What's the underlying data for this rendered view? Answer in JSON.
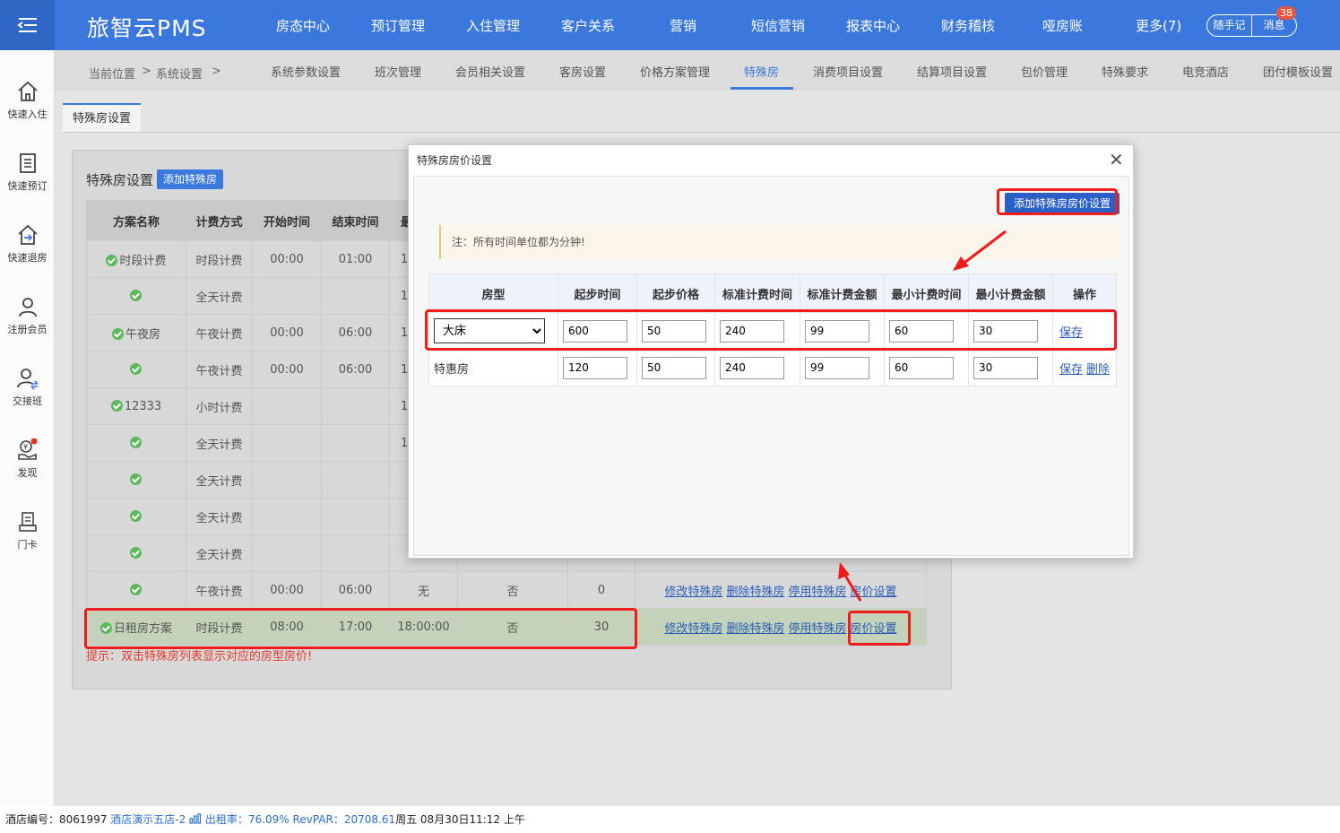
{
  "topbar": {
    "logo": "旅智云PMS",
    "nav": [
      "房态中心",
      "预订管理",
      "入住管理",
      "客户关系",
      "营销",
      "短信营销",
      "报表中心",
      "财务稽核",
      "哑房账",
      "更多(7)"
    ],
    "notes_label": "随手记",
    "messages_label": "消息",
    "messages_count": "38"
  },
  "sidebar": [
    {
      "label": "快速入住",
      "icon": "home-icon"
    },
    {
      "label": "快速预订",
      "icon": "booking-list-icon"
    },
    {
      "label": "快速退房",
      "icon": "checkout-icon"
    },
    {
      "label": "注册会员",
      "icon": "member-icon"
    },
    {
      "label": "交接班",
      "icon": "shift-swap-icon"
    },
    {
      "label": "发现",
      "icon": "discover-icon"
    },
    {
      "label": "门卡",
      "icon": "card-icon"
    }
  ],
  "breadcrumb": {
    "current": "当前位置",
    "sep1": ">",
    "section": "系统设置",
    "sep2": ">"
  },
  "subnav": [
    "系统参数设置",
    "班次管理",
    "会员相关设置",
    "客房设置",
    "价格方案管理",
    "特殊房",
    "消费项目设置",
    "结算项目设置",
    "包价管理",
    "特殊要求",
    "电竞酒店",
    "团付模板设置"
  ],
  "content_tab": "特殊房设置",
  "panel": {
    "title": "特殊房设置",
    "add_button": "添加特殊房"
  },
  "main_table": {
    "headers": [
      "方案名称",
      "计费方式",
      "开始时间",
      "结束时间",
      "最",
      "",
      "",
      ""
    ],
    "rows": [
      {
        "name": "时段计费",
        "mode": "时段计费",
        "start": "00:00",
        "end": "01:00",
        "c5": "1",
        "c6": "",
        "c7": "",
        "checked": true
      },
      {
        "name": "",
        "mode": "全天计费",
        "start": "",
        "end": "",
        "c5": "1",
        "c6": "",
        "c7": "",
        "checked": true
      },
      {
        "name": "午夜房",
        "mode": "午夜计费",
        "start": "00:00",
        "end": "06:00",
        "c5": "1",
        "c6": "",
        "c7": "",
        "checked": true
      },
      {
        "name": "",
        "mode": "午夜计费",
        "start": "00:00",
        "end": "06:00",
        "c5": "1",
        "c6": "",
        "c7": "",
        "checked": true
      },
      {
        "name": "12333",
        "mode": "小时计费",
        "start": "",
        "end": "",
        "c5": "1",
        "c6": "",
        "c7": "",
        "checked": true
      },
      {
        "name": "",
        "mode": "全天计费",
        "start": "",
        "end": "",
        "c5": "1",
        "c6": "",
        "c7": "",
        "checked": true
      },
      {
        "name": "",
        "mode": "全天计费",
        "start": "",
        "end": "",
        "c5": "",
        "c6": "",
        "c7": "",
        "checked": true
      },
      {
        "name": "",
        "mode": "全天计费",
        "start": "",
        "end": "",
        "c5": "",
        "c6": "",
        "c7": "",
        "checked": true
      },
      {
        "name": "",
        "mode": "全天计费",
        "start": "",
        "end": "",
        "c5": "",
        "c6": "",
        "c7": "",
        "checked": true
      },
      {
        "name": "",
        "mode": "午夜计费",
        "start": "00:00",
        "end": "06:00",
        "c5": "无",
        "c6": "否",
        "c7": "0",
        "checked": true
      },
      {
        "name": "日租房方案",
        "mode": "时段计费",
        "start": "08:00",
        "end": "17:00",
        "c5": "18:00:00",
        "c6": "否",
        "c7": "30",
        "checked": true
      }
    ],
    "actions": {
      "edit": "修改特殊房",
      "delete": "删除特殊房",
      "disable": "停用特殊房",
      "price": "房价设置"
    }
  },
  "hint": "提示：双击特殊房列表显示对应的房型房价!",
  "modal": {
    "title": "特殊房房价设置",
    "close": "✕",
    "add_button": "添加特殊房房价设置",
    "note": "注：所有时间单位都为分钟!",
    "headers": [
      "房型",
      "起步时间",
      "起步价格",
      "标准计费时间",
      "标准计费金额",
      "最小计费时间",
      "最小计费金额",
      "操作"
    ],
    "rows": [
      {
        "room_type": "大床",
        "start_time": "600",
        "start_price": "50",
        "std_time": "240",
        "std_amount": "99",
        "min_time": "60",
        "min_amount": "30",
        "save": "保存",
        "delete": ""
      },
      {
        "room_type": "特惠房",
        "start_time": "120",
        "start_price": "50",
        "std_time": "240",
        "std_amount": "99",
        "min_time": "60",
        "min_amount": "30",
        "save": "保存",
        "delete": "删除"
      }
    ]
  },
  "footer": {
    "hotel_id_label": "酒店编号：",
    "hotel_id": "8061997",
    "hotel_name": "酒店演示五店-2",
    "occupancy_label": "出租率：",
    "occupancy": "76.09%",
    "revpar_label": "RevPAR：",
    "revpar": "20708.61",
    "datetime": "周五 08月30日11:12 上午"
  },
  "colors": {
    "brand": "#3b78de",
    "highlight": "#f01b1b",
    "link": "#2a5db8"
  }
}
